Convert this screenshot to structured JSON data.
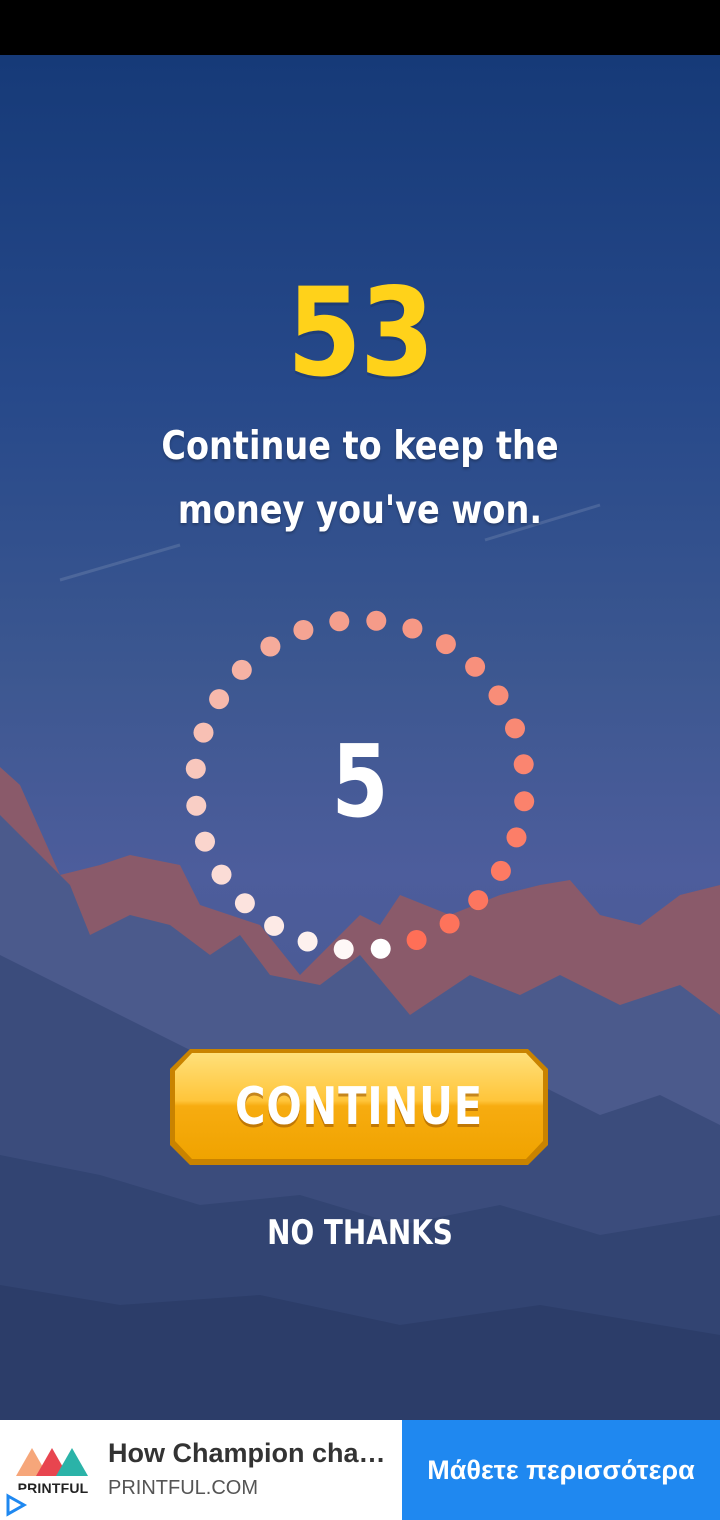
{
  "game": {
    "score": "53",
    "message": "Continue to keep the money you've won.",
    "countdown": "5",
    "countdown_dots": {
      "total": 28,
      "elapsed_color": "#ffffff",
      "remaining_colors": [
        "#f4a18f",
        "#ff6f57"
      ]
    },
    "continue_label": "CONTINUE",
    "no_thanks_label": "NO THANKS"
  },
  "ad": {
    "brand": "PRINTFUL",
    "title": "How Champion chan...",
    "domain": "PRINTFUL.COM",
    "cta": "Μάθετε περισσότερα",
    "cta_color": "#1f88f0"
  },
  "colors": {
    "score": "#ffd21a",
    "button": "#f7b21b"
  }
}
